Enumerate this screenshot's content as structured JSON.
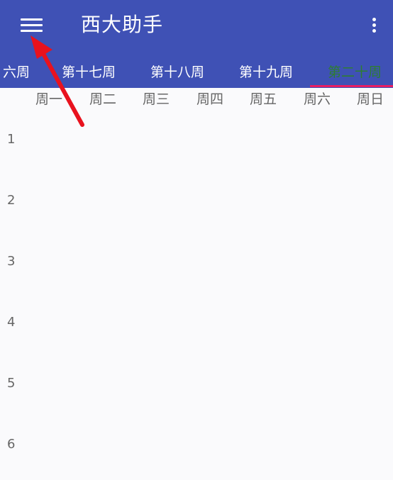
{
  "app": {
    "title": "西大助手"
  },
  "tabs": [
    {
      "label": "六周",
      "active": false
    },
    {
      "label": "第十七周",
      "active": false
    },
    {
      "label": "第十八周",
      "active": false
    },
    {
      "label": "第十九周",
      "active": false
    },
    {
      "label": "第二十周",
      "active": true
    }
  ],
  "days": [
    "周一",
    "周二",
    "周三",
    "周四",
    "周五",
    "周六",
    "周日"
  ],
  "periods": [
    "1",
    "2",
    "3",
    "4",
    "5",
    "6"
  ],
  "colors": {
    "appbar": "#3f51b5",
    "active_tab": "#2e7d32",
    "indicator": "#e91e63",
    "annotation": "#e8121e"
  },
  "icons": {
    "menu": "menu-icon",
    "overflow": "more-vertical-icon",
    "annotation": "red-arrow-icon"
  }
}
